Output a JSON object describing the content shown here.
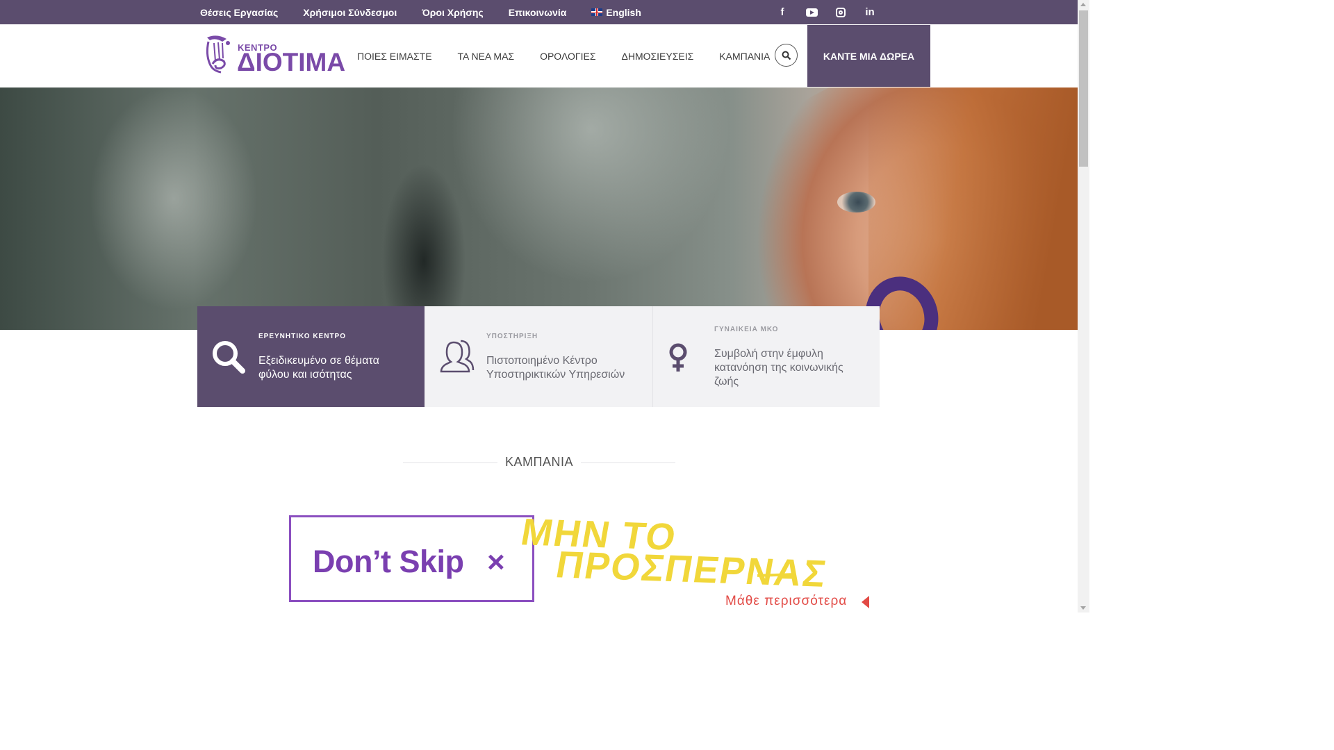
{
  "topbar": {
    "links": [
      "Θέσεις Εργασίας",
      "Χρήσιμοι Σύνδεσμοι",
      "Όροι Χρήσης",
      "Επικοινωνία"
    ],
    "language": "English",
    "socials": [
      "facebook-icon",
      "youtube-icon",
      "instagram-icon",
      "linkedin-icon"
    ],
    "facebook_glyph": "f",
    "linkedin_glyph": "in"
  },
  "header": {
    "logo_small": "ΚΕΝΤΡΟ",
    "logo_big": "ΔΙΟΤΙΜΑ",
    "nav": [
      "ΠΟΙΕΣ ΕΙΜΑΣΤΕ",
      "ΤΑ ΝΕΑ ΜΑΣ",
      "ΟΡΟΛΟΓΙΕΣ",
      "ΔΗΜΟΣΙΕΥΣΕΙΣ",
      "ΚΑΜΠΑΝΙΑ"
    ],
    "donate": "ΚΑΝΤΕ ΜΙΑ ΔΩΡΕΑ"
  },
  "features": [
    {
      "kicker": "ΕΡΕΥΝΗΤΙΚΟ ΚΕΝΤΡΟ",
      "text": "Εξειδικευμένο σε θέματα φύλου και ισότητας",
      "icon": "search-icon"
    },
    {
      "kicker": "ΥΠΟΣΤΗΡΙΞΗ",
      "text": "Πιστοποιημένο Κέντρο Υποστηρικτικών Υπηρεσιών",
      "icon": "people-icon"
    },
    {
      "kicker": "ΓΥΝΑΙΚΕΙΑ ΜΚΟ",
      "text": "Συμβολή στην έμφυλη κατανόηση της κοινωνικής ζωής",
      "icon": "venus-icon"
    }
  ],
  "campaign": {
    "section_title": "ΚΑΜΠΑΝΙΑ",
    "banner_english": "Don’t Skip",
    "banner_x": "×",
    "banner_greek_line1": "ΜΗΝ ΤΟ",
    "banner_greek_line2": "ΠΡΟΣΠΕΡΝΑΣ",
    "learn_more": "Μάθε περισσότερα"
  },
  "colors": {
    "brand_purple": "#5b4d6e",
    "logo_purple": "#7a4aa8",
    "campaign_purple": "#8b4fc0",
    "campaign_yellow": "#f1d73a",
    "learn_more_red": "#e24a45"
  }
}
